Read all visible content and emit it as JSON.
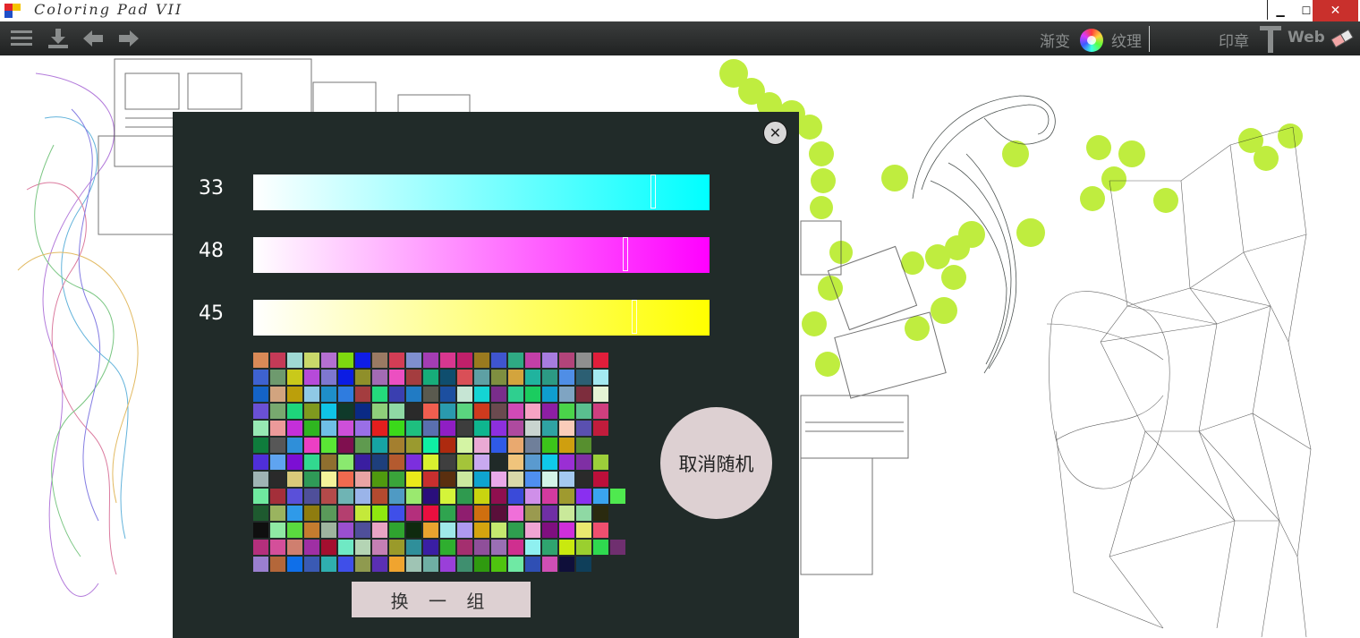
{
  "window": {
    "title": "Coloring Pad VII",
    "minimize_glyph": "▁",
    "maximize_glyph": "☐",
    "close_glyph": "✕"
  },
  "toolbar": {
    "left_icons": [
      "menu-icon",
      "download-icon",
      "undo-arrow-icon",
      "redo-arrow-icon"
    ],
    "gradient_label": "渐变",
    "texture_label": "纹理",
    "stamp_label": "印章",
    "web_label": "Web",
    "right_icons": [
      "color-wheel-icon",
      "text-tool-icon",
      "eraser-icon"
    ]
  },
  "dialog": {
    "close_glyph": "✕",
    "sliders": [
      {
        "label": "33",
        "color": "#00ffff",
        "value_fraction": 0.87
      },
      {
        "label": "48",
        "color": "#ff00ff",
        "value_fraction": 0.81
      },
      {
        "label": "45",
        "color": "#ffff00",
        "value_fraction": 0.83
      }
    ],
    "random_button_label": "取消随机",
    "swap_button_label": "换 一 组",
    "palette_columns": 22,
    "palette": [
      "#d98a57",
      "#c43a57",
      "#9fd9d4",
      "#c9d86a",
      "#b46fd1",
      "#7ed90f",
      "#0f1de6",
      "#9a7a63",
      "#d33d55",
      "#7f8fcf",
      "#a43db3",
      "#d8378f",
      "#c0206a",
      "#9a7a1f",
      "#3f55cf",
      "#2faa83",
      "#c23fa7",
      "#a77cdf",
      "#b2447a",
      "#8f8f8f",
      "#e01e3b",
      "#212b29",
      "#3e62d0",
      "#6e9a6e",
      "#c9c91a",
      "#b64ad9",
      "#7e77d0",
      "#0b1ce3",
      "#8f8f2a",
      "#a26bb3",
      "#ec4fc1",
      "#a43d3f",
      "#17ad7a",
      "#0f4e6e",
      "#d94f57",
      "#5ea0a4",
      "#7f8f40",
      "#d3a43d",
      "#20b39e",
      "#2c9a84",
      "#4f8ee6",
      "#2c5f73",
      "#a4e9f0",
      "#212b29",
      "#1463c6",
      "#d2a47f",
      "#bb9f0b",
      "#8fc9e6",
      "#1e8fc9",
      "#2f7cdf",
      "#a43d3f",
      "#24d97c",
      "#3a3fb0",
      "#217bc4",
      "#5a5a4f",
      "#1c4fa0",
      "#c6e5d4",
      "#14d4d4",
      "#7a2d8b",
      "#2fcf8f",
      "#1bcc5f",
      "#0f9ecf",
      "#7fa4c2",
      "#7d2d3d",
      "#e5f4d4",
      "#212b29",
      "#6a50d4",
      "#78a96f",
      "#1ed57b",
      "#7f9a1e",
      "#0fc4e6",
      "#0f3a2a",
      "#0a2a85",
      "#8ecf7a",
      "#8fd9a4",
      "#2a2a2a",
      "#f05e4f",
      "#2a9aae",
      "#5ad47f",
      "#cf3a1e",
      "#6a4a4f",
      "#d04ab6",
      "#f7a3c4",
      "#8d1ea4",
      "#4ad44a",
      "#5abf8f",
      "#cf3f7f",
      "#212b29",
      "#97e9b4",
      "#ec9a9a",
      "#c42fd9",
      "#2fb520",
      "#6fbfe6",
      "#cd4fd9",
      "#9a6fe6",
      "#e31e1e",
      "#3bd91a",
      "#1ebf7f",
      "#5a6faf",
      "#8f1ec4",
      "#3d3d3d",
      "#0fb58f",
      "#8d2fde",
      "#ae4a9f",
      "#c9d4cf",
      "#2fa3a3",
      "#f9ccb9",
      "#5a50b0",
      "#c11c3c",
      "#212b29",
      "#0f7c3c",
      "#575757",
      "#2f8fd9",
      "#ec3fc4",
      "#5ae635",
      "#7f0f4f",
      "#5f9a4f",
      "#16a4a4",
      "#a47f2f",
      "#9a9a2f",
      "#0ff0a4",
      "#ae2a0f",
      "#d4f4a4",
      "#e9a9d4",
      "#2f5ae6",
      "#e9a96f",
      "#6f7f9a",
      "#3cc41a",
      "#cf9f0f",
      "#578f2f",
      "#212b29",
      "#212b29",
      "#4f2fd9",
      "#5fa4f0",
      "#7c0fd4",
      "#32d98f",
      "#8f6f2f",
      "#8ae96f",
      "#3a1ea0",
      "#1e3f7c",
      "#b45a2f",
      "#7c2fde",
      "#d9f02f",
      "#3f3f3f",
      "#a4c43a",
      "#c9a9f0",
      "#202a28",
      "#f0c47c",
      "#5a9acf",
      "#0fc9e9",
      "#9a2fd4",
      "#7f2fa4",
      "#9ccf3a",
      "#212b29",
      "#9fb4b4",
      "#2a2a2a",
      "#d9c97a",
      "#2f9a57",
      "#f4f49a",
      "#f06a4f",
      "#e9a4a4",
      "#4f9a0f",
      "#3aa43a",
      "#e9e91a",
      "#c72f2f",
      "#5a2f0f",
      "#cbe99f",
      "#0fa4cf",
      "#e9a9e9",
      "#d9d9a9",
      "#4f8ff0",
      "#d4f4e9",
      "#a4c9f0",
      "#2a2a2a",
      "#bb0f3a",
      "#212b29",
      "#6fe99f",
      "#a42f3a",
      "#5a50d9",
      "#4f4f9a",
      "#b44a4a",
      "#6fb4b4",
      "#9ab4e9",
      "#b44a2f",
      "#4f9ac4",
      "#9ae96f",
      "#2a0f7c",
      "#d4f43a",
      "#2f9a4f",
      "#c9d40f",
      "#8f0f4f",
      "#3a4ad9",
      "#cf8fe9",
      "#d43a9f",
      "#9f9a2f",
      "#8a2ff0",
      "#3aa4ef",
      "#4fe94f",
      "#1e5a2f",
      "#9ab45f",
      "#2f9ae9",
      "#8f7c0f",
      "#5a9a5a",
      "#b43f6f",
      "#c4e93a",
      "#8fe90f",
      "#3f4fe9",
      "#b42f7c",
      "#e90f3f",
      "#2fa44f",
      "#8f1e6f",
      "#cf6f0f",
      "#5a0f3a",
      "#f06fd9",
      "#9a9a4f",
      "#6f2fa4",
      "#c9e99a",
      "#8fd9a4",
      "#2a2a0f",
      "#212b29",
      "#0f0f0f",
      "#8fe9a4",
      "#5ad93f",
      "#c47c2f",
      "#9fb49f",
      "#9a4fcf",
      "#4f4f9a",
      "#e9a4c4",
      "#2fa42f",
      "#0f2a0f",
      "#e9a42f",
      "#9fe9e9",
      "#ae9af0",
      "#d4a40f",
      "#c4e96f",
      "#2f9f4f",
      "#f0a4d4",
      "#7f0f7f",
      "#cf2fd9",
      "#e9e96f",
      "#ef4f6f",
      "#212b29",
      "#b42f7c",
      "#d44f9a",
      "#cf7f6f",
      "#9f2fa4",
      "#a40f2f",
      "#6fe9c4",
      "#b4d4b4",
      "#c47fb4",
      "#9a9a2a",
      "#2f8f9a",
      "#3a1ea4",
      "#2fae2f",
      "#a42f6f",
      "#8f4f9a",
      "#9a6fb4",
      "#cf2f8f",
      "#8ff0f0",
      "#2fa46f",
      "#c9e90f",
      "#9acf2f",
      "#2fd94f",
      "#6f2f6f",
      "#9a7fcf",
      "#b4673a",
      "#0f6fe9",
      "#3a5ab4",
      "#2fafaf",
      "#3f4fe9",
      "#8f9a4f",
      "#5a2fb4",
      "#f0a42f",
      "#9fc4b4",
      "#6fafa4",
      "#9a3fd9",
      "#3f8f6f",
      "#2f9a0f",
      "#4fc40f",
      "#6fe9a4",
      "#2f4fb4",
      "#cf4fb4",
      "#0f0f3a",
      "#0f3f5a",
      "#212b29",
      "#212b29"
    ]
  }
}
